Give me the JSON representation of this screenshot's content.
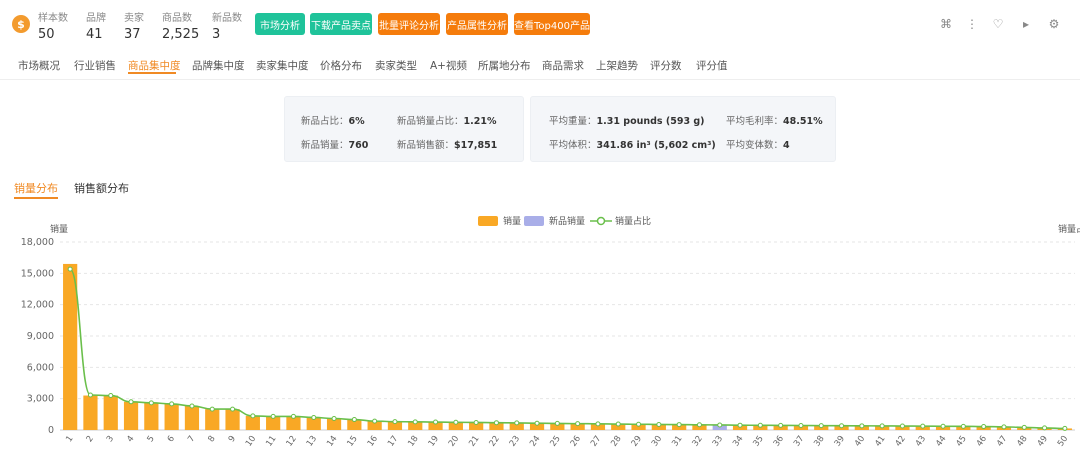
{
  "header": {
    "stats": [
      {
        "label": "样本数",
        "value": "50"
      },
      {
        "label": "品牌",
        "value": "41"
      },
      {
        "label": "卖家",
        "value": "37"
      },
      {
        "label": "商品数",
        "value": "2,525"
      },
      {
        "label": "新品数",
        "value": "3"
      }
    ],
    "buttons": [
      {
        "label": "市场分析",
        "color": "#1fc39a"
      },
      {
        "label": "下载产品卖点",
        "color": "#1fc39a"
      },
      {
        "label": "批量评论分析",
        "color": "#f57c0c"
      },
      {
        "label": "产品属性分析",
        "color": "#f57c0c"
      },
      {
        "label": "查看Top400产品",
        "color": "#f57c0c"
      }
    ],
    "icons": [
      "grid-icon",
      "more-icon",
      "heart-icon",
      "play-icon",
      "gear-icon"
    ]
  },
  "tabs": [
    "市场概况",
    "行业销售",
    "商品集中度",
    "品牌集中度",
    "卖家集中度",
    "价格分布",
    "卖家类型",
    "A+视频",
    "所属地分布",
    "商品需求",
    "上架趋势",
    "评分数",
    "评分值"
  ],
  "active_tab": "商品集中度",
  "summary": {
    "left": [
      {
        "label": "新品占比：",
        "value": "6%"
      },
      {
        "label": "新品销量占比：",
        "value": "1.21%"
      },
      {
        "label": "新品销量：",
        "value": "760"
      },
      {
        "label": "新品销售额：",
        "value": "$17,851"
      }
    ],
    "right": [
      {
        "label": "平均重量：",
        "value": "1.31 pounds (593 g)"
      },
      {
        "label": "平均毛利率：",
        "value": "48.51%"
      },
      {
        "label": "平均体积：",
        "value": "341.86 in³ (5,602 cm³)"
      },
      {
        "label": "平均变体数：",
        "value": "4"
      }
    ]
  },
  "subtabs": [
    "销量分布",
    "销售额分布"
  ],
  "chart_data": {
    "type": "bar",
    "ylabel": "销量",
    "y2label": "销量占比",
    "ylim": [
      0,
      18000
    ],
    "yticks": [
      "18,000",
      "15,000",
      "12,000",
      "9,000",
      "6,000",
      "3,000",
      "0"
    ],
    "legend": [
      "销量",
      "新品销量",
      "销量占比"
    ],
    "colors": {
      "sales": "#f9a825",
      "new": "#a9aee8",
      "line": "#6abf4b"
    },
    "categories": [
      "1",
      "2",
      "3",
      "4",
      "5",
      "6",
      "7",
      "8",
      "9",
      "10",
      "11",
      "12",
      "13",
      "14",
      "15",
      "16",
      "17",
      "18",
      "19",
      "20",
      "21",
      "22",
      "23",
      "24",
      "25",
      "26",
      "27",
      "28",
      "29",
      "30",
      "31",
      "32",
      "33",
      "34",
      "35",
      "36",
      "37",
      "38",
      "39",
      "40",
      "41",
      "42",
      "43",
      "44",
      "45",
      "46",
      "47",
      "48",
      "49",
      "50"
    ],
    "series": [
      {
        "name": "销量",
        "values": [
          15900,
          3300,
          3300,
          2700,
          2600,
          2500,
          2300,
          2000,
          2000,
          1350,
          1300,
          1300,
          1200,
          1100,
          1000,
          850,
          800,
          780,
          760,
          740,
          720,
          700,
          680,
          650,
          630,
          610,
          590,
          570,
          550,
          530,
          520,
          500,
          0,
          460,
          450,
          440,
          430,
          420,
          410,
          400,
          390,
          380,
          370,
          360,
          350,
          330,
          300,
          250,
          200,
          150
        ]
      },
      {
        "name": "新品销量",
        "values": [
          0,
          0,
          0,
          0,
          0,
          0,
          0,
          0,
          0,
          0,
          0,
          0,
          0,
          0,
          0,
          0,
          0,
          0,
          0,
          0,
          0,
          0,
          0,
          0,
          0,
          0,
          0,
          0,
          0,
          0,
          0,
          0,
          480,
          0,
          0,
          0,
          0,
          0,
          0,
          0,
          0,
          0,
          0,
          0,
          0,
          0,
          0,
          0,
          0,
          0
        ]
      },
      {
        "name": "销量占比",
        "values": [
          15400,
          3350,
          3300,
          2700,
          2600,
          2500,
          2300,
          2000,
          2000,
          1350,
          1300,
          1300,
          1200,
          1100,
          1000,
          850,
          800,
          780,
          760,
          740,
          720,
          700,
          680,
          650,
          630,
          610,
          590,
          570,
          550,
          530,
          520,
          500,
          480,
          460,
          450,
          440,
          430,
          420,
          410,
          400,
          390,
          380,
          370,
          360,
          350,
          330,
          300,
          250,
          200,
          150
        ]
      }
    ]
  }
}
